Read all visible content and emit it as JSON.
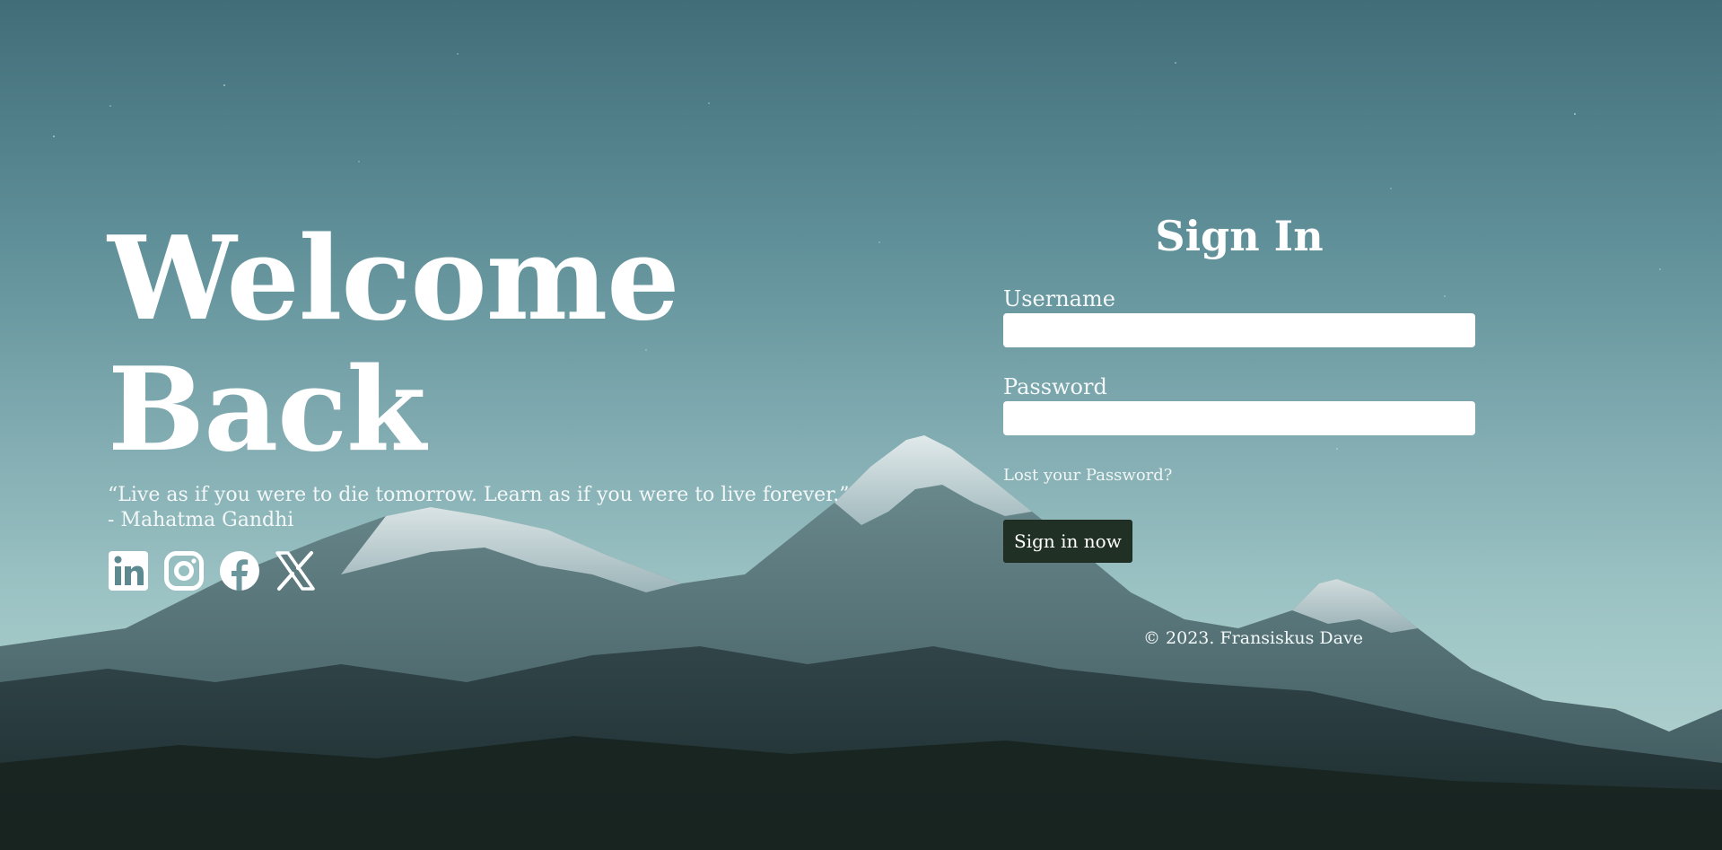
{
  "hero": {
    "title_line1": "Welcome",
    "title_line2": "Back",
    "quote_line1": "“Live as if you were to die tomorrow. Learn as if you were to live forever.”",
    "quote_line2": "- Mahatma Gandhi"
  },
  "socials": [
    {
      "icon": "linkedin-icon"
    },
    {
      "icon": "instagram-icon"
    },
    {
      "icon": "facebook-icon"
    },
    {
      "icon": "x-icon"
    }
  ],
  "signin": {
    "title": "Sign In",
    "username_label": "Username",
    "username_value": "",
    "password_label": "Password",
    "password_value": "",
    "lost_password": "Lost your Password?",
    "submit_label": "Sign in now"
  },
  "footer": {
    "copyright": "© 2023. Fransiskus Dave"
  },
  "colors": {
    "sky_top": "#416d79",
    "sky_bottom": "#b9d8d4",
    "button_bg": "#203024",
    "text": "#ffffff"
  }
}
